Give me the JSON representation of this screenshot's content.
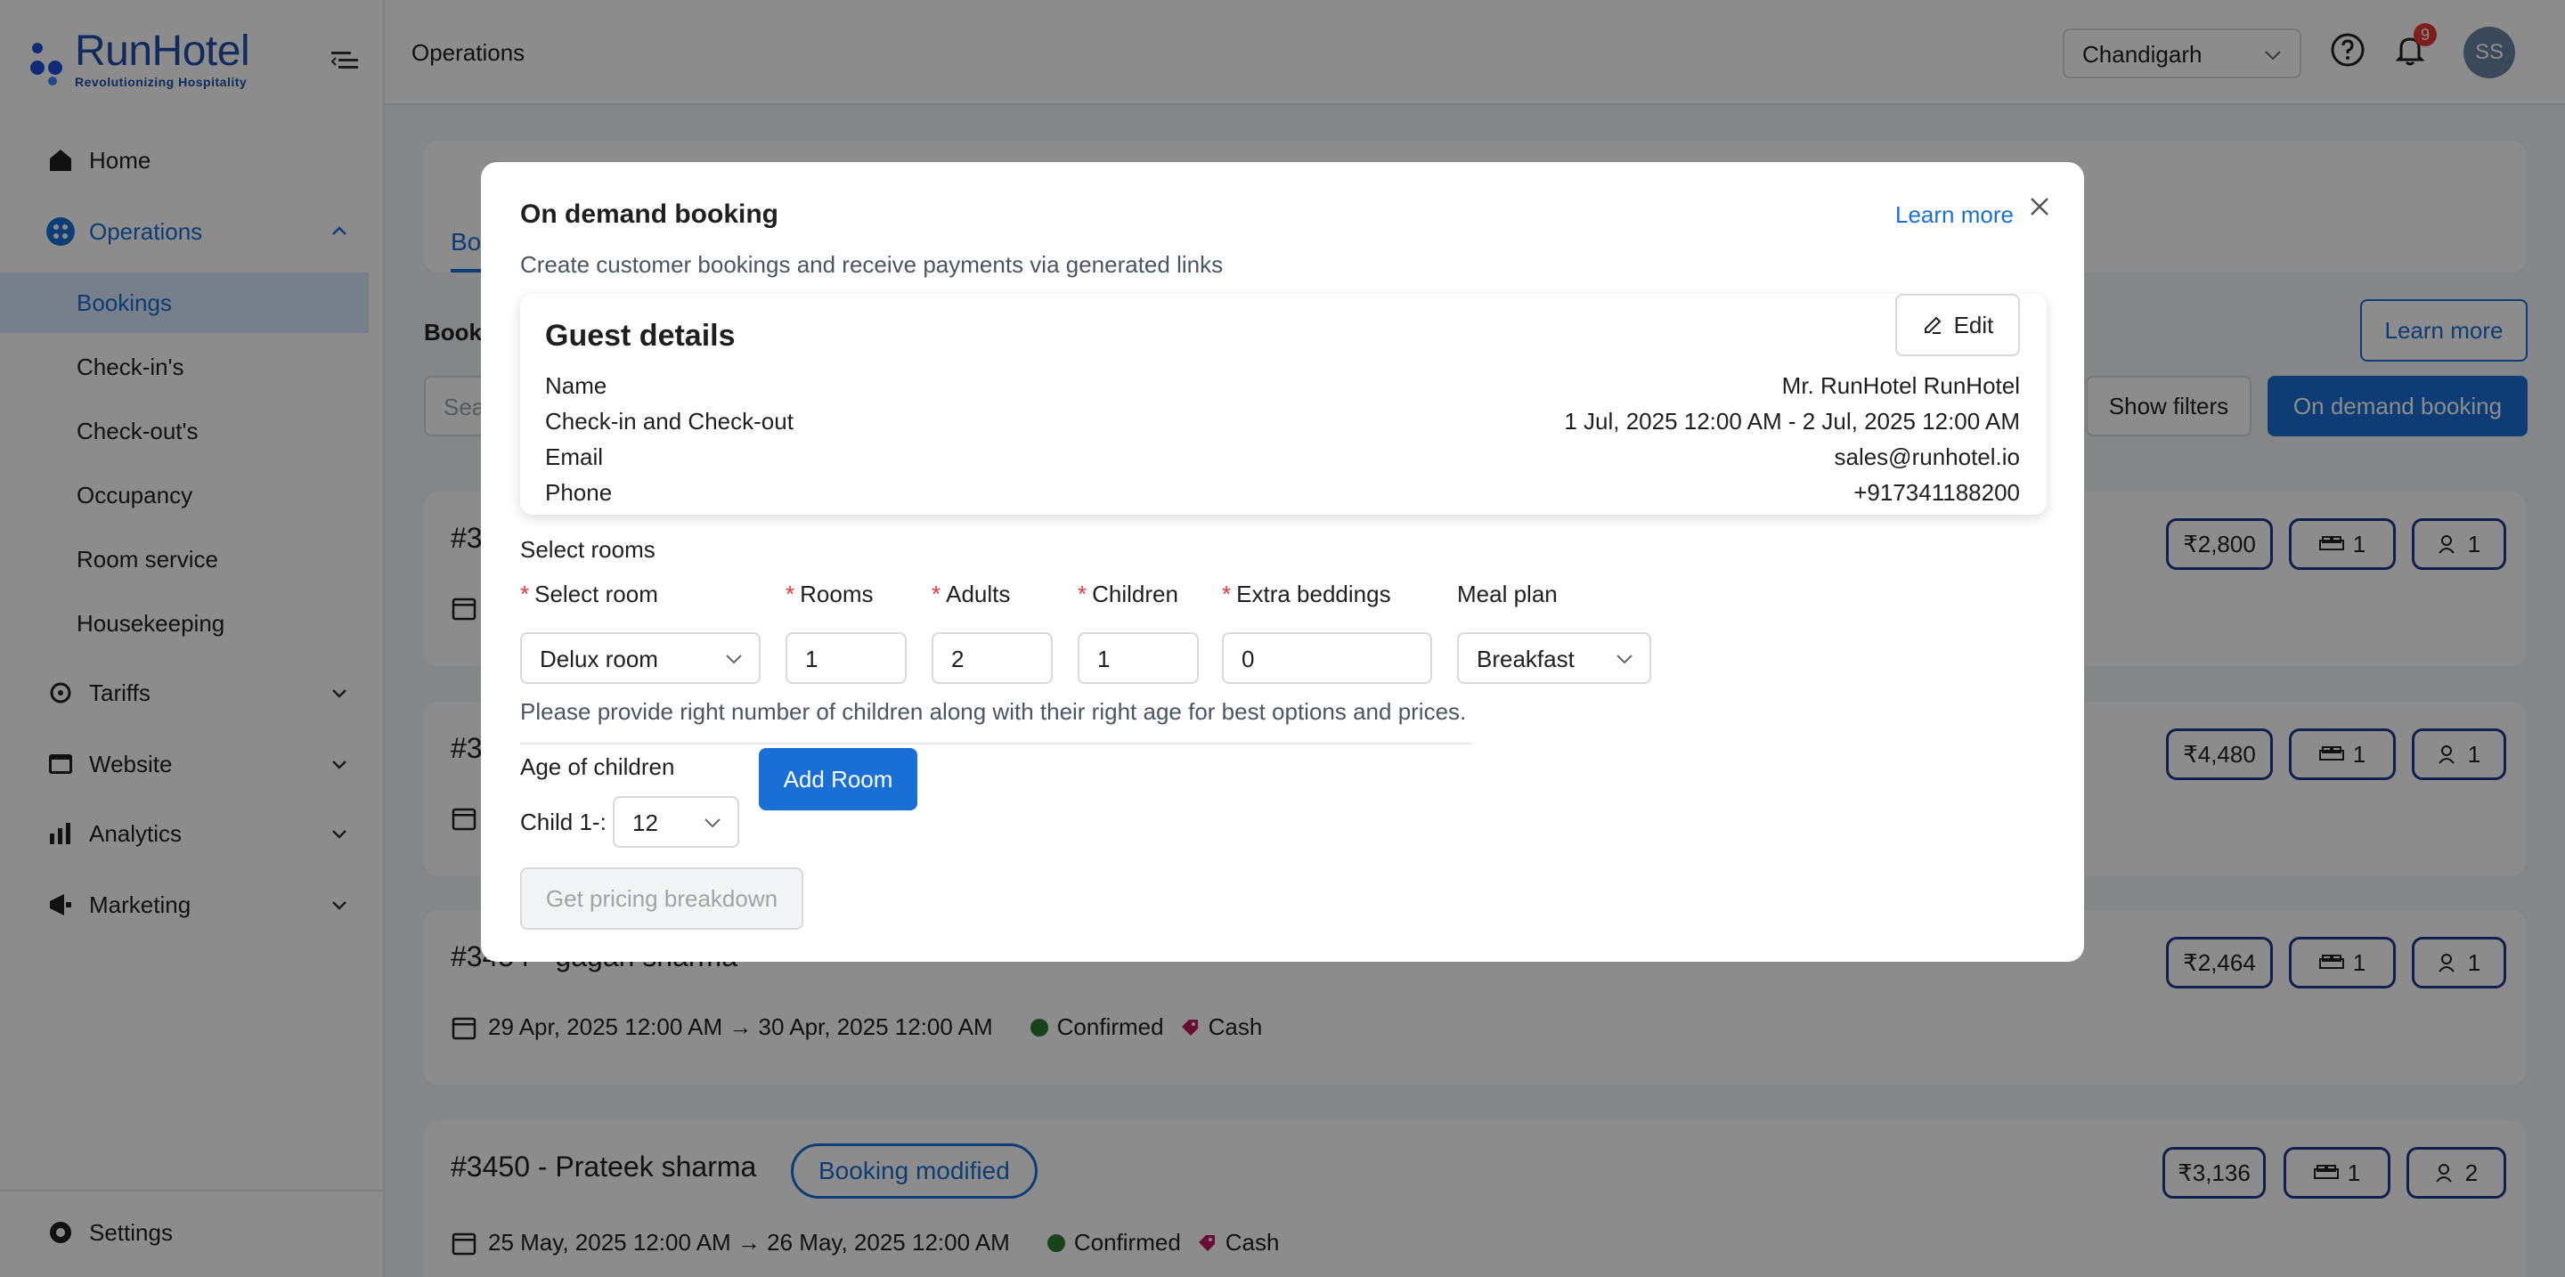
{
  "brand": {
    "name": "RunHotel",
    "tagline": "Revolutionizing Hospitality"
  },
  "sidebar": {
    "items": [
      {
        "label": "Home",
        "icon": "home-icon"
      },
      {
        "label": "Operations",
        "icon": "operations-icon"
      },
      {
        "label": "Tariffs",
        "icon": "tariffs-icon"
      },
      {
        "label": "Website",
        "icon": "website-icon"
      },
      {
        "label": "Analytics",
        "icon": "analytics-icon"
      },
      {
        "label": "Marketing",
        "icon": "marketing-icon"
      }
    ],
    "operations_sub": [
      "Bookings",
      "Check-in's",
      "Check-out's",
      "Occupancy",
      "Room service",
      "Housekeeping"
    ],
    "settings": "Settings"
  },
  "topbar": {
    "title": "Operations",
    "city": "Chandigarh",
    "notification_count": "9",
    "avatar_initials": "SS"
  },
  "page": {
    "tab_label": "Boo",
    "section_title": "Book",
    "learn_more": "Learn more",
    "search_placeholder": "Sea",
    "show_filters": "Show filters",
    "on_demand_booking": "On demand booking"
  },
  "bookings": [
    {
      "title": "#3",
      "dates": "",
      "price": "₹2,800",
      "rooms": "1",
      "guests": "1",
      "modified": ""
    },
    {
      "title": "#3",
      "dates": "",
      "price": "₹4,480",
      "rooms": "1",
      "guests": "1",
      "modified": ""
    },
    {
      "title": "#3454 - gagan sharma",
      "dates": "29 Apr, 2025 12:00 AM → 30 Apr, 2025 12:00 AM",
      "status": "Confirmed",
      "payment": "Cash",
      "price": "₹2,464",
      "rooms": "1",
      "guests": "1",
      "modified": ""
    },
    {
      "title": "#3450 - Prateek sharma",
      "dates": "25 May, 2025 12:00 AM → 26 May, 2025 12:00 AM",
      "status": "Confirmed",
      "payment": "Cash",
      "price": "₹3,136",
      "rooms": "1",
      "guests": "2",
      "modified": "Booking modified"
    }
  ],
  "modal": {
    "title": "On demand booking",
    "subtitle": "Create customer bookings and receive payments via generated links",
    "learn_more": "Learn more",
    "guest": {
      "title": "Guest details",
      "edit": "Edit",
      "rows": [
        {
          "k": "Name",
          "v": "Mr. RunHotel RunHotel"
        },
        {
          "k": "Check-in and Check-out",
          "v": "1 Jul, 2025 12:00 AM - 2 Jul, 2025 12:00 AM"
        },
        {
          "k": "Email",
          "v": "sales@runhotel.io"
        },
        {
          "k": "Phone",
          "v": "+917341188200"
        }
      ]
    },
    "select_rooms_label": "Select rooms",
    "fields": {
      "select_room": {
        "label": "Select room",
        "value": "Delux room"
      },
      "rooms": {
        "label": "Rooms",
        "value": "1"
      },
      "adults": {
        "label": "Adults",
        "value": "2"
      },
      "children": {
        "label": "Children",
        "value": "1"
      },
      "extra_beddings": {
        "label": "Extra beddings",
        "value": "0"
      },
      "meal_plan": {
        "label": "Meal plan",
        "value": "Breakfast"
      }
    },
    "hint": "Please provide right number of children along with their right age for best options and prices.",
    "age_label": "Age of children",
    "child_label": "Child 1-:",
    "child_age": "12",
    "add_room": "Add Room",
    "pricing": "Get pricing breakdown"
  },
  "colors": {
    "accent": "#1a6fd6",
    "required": "#e53935",
    "confirmed": "#2e7d32"
  }
}
